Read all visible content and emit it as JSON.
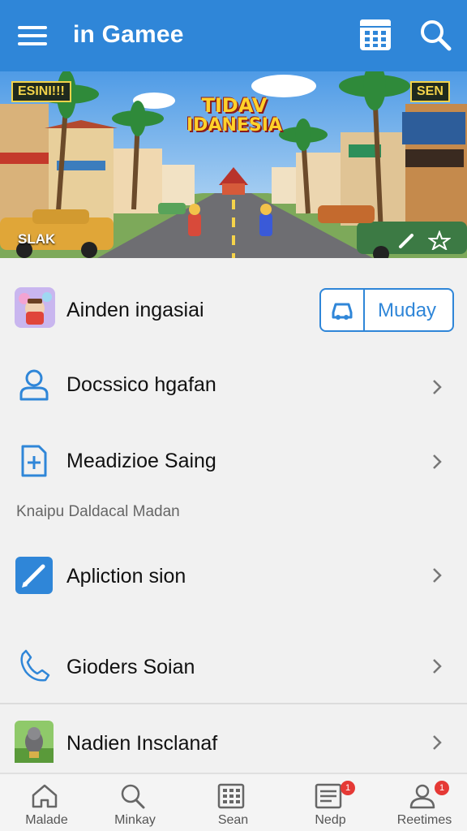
{
  "header": {
    "title": "in Gamee",
    "menu_icon": "hamburger-icon",
    "calendar_icon": "calendar-icon",
    "search_icon": "search-icon"
  },
  "banner": {
    "left_sign": "ESINI!!!",
    "right_sign": "SEN",
    "logo_line1": "TIDAV",
    "logo_line2": "IDANESIA",
    "caption": "SLAK"
  },
  "list": {
    "profile": {
      "label": "Ainden ingasiai",
      "button_label": "Muday",
      "button_icon": "car-icon"
    },
    "items": [
      {
        "label": "Docssico hgafan",
        "icon": "person-icon"
      },
      {
        "label": "Meadizioe Saing",
        "icon": "document-add-icon"
      }
    ],
    "section_label": "Knaipu Daldacal Madan",
    "items2": [
      {
        "label": "Apliction sion",
        "icon": "pencil-icon"
      },
      {
        "label": "Gioders Soian",
        "icon": "phone-icon"
      },
      {
        "label": "Nadien Insclanaf",
        "icon": "game-thumbnail"
      }
    ]
  },
  "bottom_nav": [
    {
      "label": "Malade",
      "icon": "home-icon",
      "badge": ""
    },
    {
      "label": "Minkay",
      "icon": "search-icon",
      "badge": ""
    },
    {
      "label": "Sean",
      "icon": "grid-icon",
      "badge": ""
    },
    {
      "label": "Nedp",
      "icon": "inbox-icon",
      "badge": "1"
    },
    {
      "label": "Reetimes",
      "icon": "profile-icon",
      "badge": "1"
    }
  ],
  "colors": {
    "accent": "#2f86d8",
    "badge": "#e53935",
    "background": "#f1f1f1"
  }
}
